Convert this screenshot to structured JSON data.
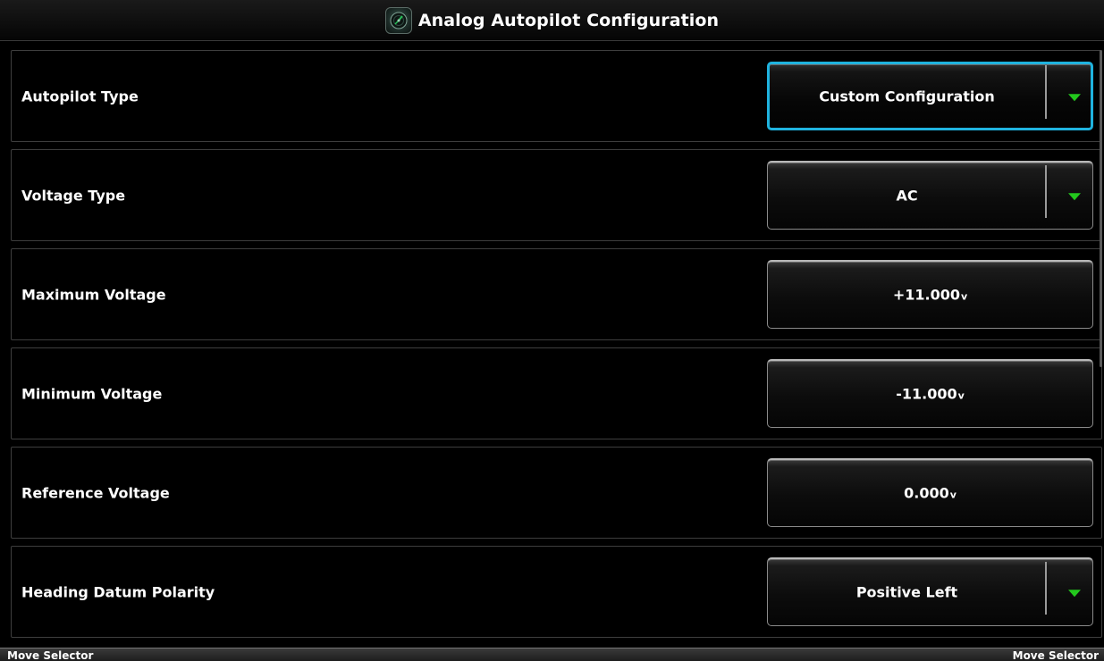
{
  "header": {
    "title": "Analog Autopilot Configuration",
    "icon": "gauge-icon"
  },
  "rows": [
    {
      "label": "Autopilot Type",
      "value": "Custom Configuration",
      "kind": "dropdown",
      "focused": true
    },
    {
      "label": "Voltage Type",
      "value": "AC",
      "kind": "dropdown",
      "focused": false
    },
    {
      "label": "Maximum Voltage",
      "value": "+11.000",
      "unit": "v",
      "kind": "numeric",
      "focused": false
    },
    {
      "label": "Minimum Voltage",
      "value": "-11.000",
      "unit": "v",
      "kind": "numeric",
      "focused": false
    },
    {
      "label": "Reference Voltage",
      "value": "0.000",
      "unit": "v",
      "kind": "numeric",
      "focused": false
    },
    {
      "label": "Heading Datum Polarity",
      "value": "Positive Left",
      "kind": "dropdown",
      "focused": false
    }
  ],
  "softkeys": {
    "left": "Move Selector",
    "right": "Move Selector"
  },
  "colors": {
    "focus_border": "#1fb3df",
    "dropdown_arrow": "#23c81d",
    "background": "#000000"
  }
}
